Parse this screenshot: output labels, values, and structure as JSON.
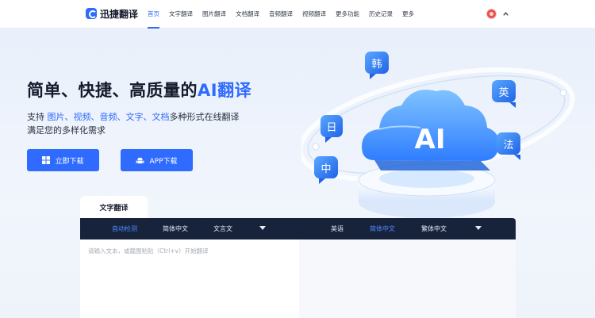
{
  "header": {
    "logo_text": "迅捷翻译",
    "nav": [
      {
        "label": "首页",
        "active": true
      },
      {
        "label": "文字翻译"
      },
      {
        "label": "图片翻译"
      },
      {
        "label": "文档翻译"
      },
      {
        "label": "音频翻译"
      },
      {
        "label": "视频翻译"
      },
      {
        "label": "更多功能"
      },
      {
        "label": "历史记录"
      },
      {
        "label": "更多"
      }
    ]
  },
  "hero": {
    "headline_main": "简单、快捷、高质量的",
    "headline_ai": "AI翻译",
    "subtitle_prefix": "支持 ",
    "subtitle_formats": "图片、视频、音频、文字、文档",
    "subtitle_suffix": "多种形式在线翻译",
    "subtitle_line2": "满足您的多样化需求",
    "download_button": "立即下载",
    "app_button": "APP下载",
    "illustration": {
      "cloud_text": "AI",
      "badges": [
        "韩",
        "日",
        "英",
        "法",
        "中"
      ]
    }
  },
  "translator": {
    "tab_label": "文字翻译",
    "source_langs": [
      {
        "label": "自动检测",
        "active": true
      },
      {
        "label": "简体中文"
      },
      {
        "label": "文言文"
      }
    ],
    "target_langs": [
      {
        "label": "英语"
      },
      {
        "label": "简体中文",
        "active": true
      },
      {
        "label": "繁体中文"
      }
    ],
    "input_placeholder": "请输入文本，或截图粘贴（Ctrl+v）开始翻译"
  },
  "colors": {
    "accent": "#2f6bff",
    "lang_bar_bg": "#17223b"
  }
}
